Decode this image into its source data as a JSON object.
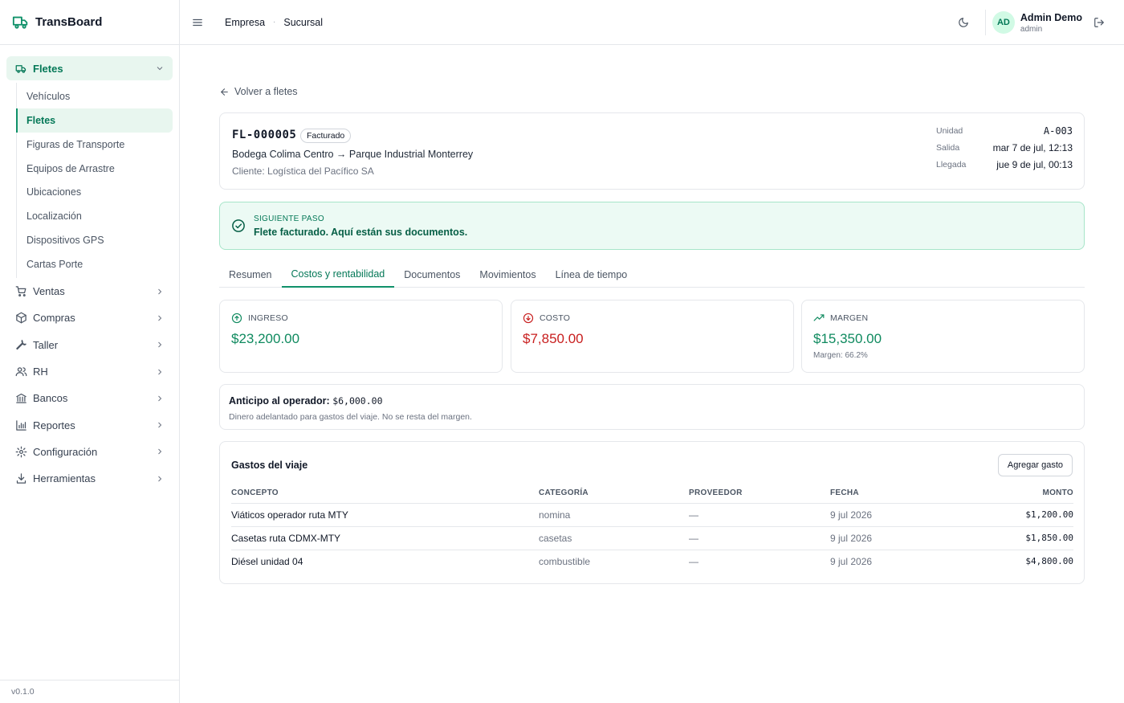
{
  "app": {
    "name": "TransBoard",
    "version": "v0.1.0"
  },
  "sidebar": {
    "groups": [
      {
        "label": "Fletes",
        "icon": "truck-icon",
        "expanded": true,
        "items": [
          "Vehículos",
          "Fletes",
          "Figuras de Transporte",
          "Equipos de Arrastre",
          "Ubicaciones",
          "Localización",
          "Dispositivos GPS",
          "Cartas Porte"
        ]
      },
      {
        "label": "Ventas",
        "icon": "cart-icon"
      },
      {
        "label": "Compras",
        "icon": "package-icon"
      },
      {
        "label": "Taller",
        "icon": "wrench-icon"
      },
      {
        "label": "RH",
        "icon": "users-icon"
      },
      {
        "label": "Bancos",
        "icon": "bank-icon"
      },
      {
        "label": "Reportes",
        "icon": "bar-chart-icon"
      },
      {
        "label": "Configuración",
        "icon": "gear-icon"
      },
      {
        "label": "Herramientas",
        "icon": "download-icon"
      }
    ]
  },
  "topbar": {
    "breadcrumb": [
      "Empresa",
      "Sucursal"
    ],
    "user": {
      "initials": "AD",
      "name": "Admin Demo",
      "role": "admin"
    }
  },
  "main": {
    "back_label": "Volver a fletes",
    "flete": {
      "code": "FL-000005",
      "status": "Facturado",
      "route": "Bodega Colima Centro → Parque Industrial Monterrey",
      "client": "Cliente: Logística del Pacífico SA",
      "meta": [
        {
          "k": "Unidad",
          "v": "A-003"
        },
        {
          "k": "Salida",
          "v": "mar 7 de jul, 12:13"
        },
        {
          "k": "Llegada",
          "v": "jue 9 de jul, 00:13"
        }
      ]
    },
    "next_step": {
      "kicker": "SIGUIENTE PASO",
      "message": "Flete facturado. Aquí están sus documentos."
    },
    "tabs": [
      "Resumen",
      "Costos y rentabilidad",
      "Documentos",
      "Movimientos",
      "Línea de tiempo"
    ],
    "active_tab": "Costos y rentabilidad",
    "kpis": {
      "ingreso": {
        "label": "INGRESO",
        "value": "$23,200.00",
        "color": "#0f8a5f"
      },
      "costo": {
        "label": "COSTO",
        "value": "$7,850.00",
        "color": "#c81e1e"
      },
      "margen": {
        "label": "MARGEN",
        "value": "$15,350.00",
        "sub": "Margen: 66.2%",
        "color": "#0f8a5f"
      }
    },
    "anticipo": {
      "title": "Anticipo al operador:",
      "value": "$6,000.00",
      "note": "Dinero adelantado para gastos del viaje. No se resta del margen."
    },
    "gastos": {
      "title": "Gastos del viaje",
      "add_label": "Agregar gasto",
      "columns": [
        "CONCEPTO",
        "CATEGORÍA",
        "PROVEEDOR",
        "FECHA",
        "MONTO"
      ],
      "rows": [
        [
          "Viáticos operador ruta MTY",
          "nomina",
          "—",
          "9 jul 2026",
          "$1,200.00"
        ],
        [
          "Casetas ruta CDMX-MTY",
          "casetas",
          "—",
          "9 jul 2026",
          "$1,850.00"
        ],
        [
          "Diésel unidad 04",
          "combustible",
          "—",
          "9 jul 2026",
          "$4,800.00"
        ]
      ]
    }
  },
  "colors": {
    "accent": "#10916a",
    "accent_bg": "#e8f6ef",
    "success_bg": "#ecfaf4"
  }
}
